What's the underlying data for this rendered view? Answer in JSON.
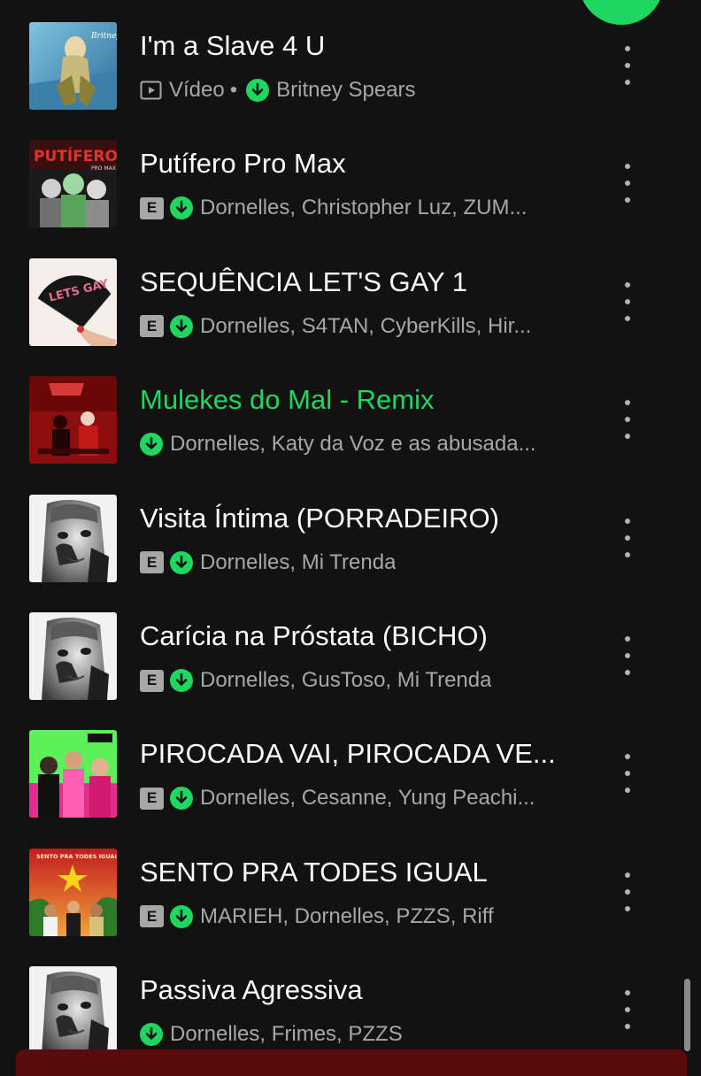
{
  "colors": {
    "background": "#121212",
    "accent_green": "#1ed760",
    "secondary_text": "#a7a7a7",
    "mini_player": "#5a0c0c"
  },
  "tracks": [
    {
      "title": "I'm a Slave 4 U",
      "type_label": "Vídeo",
      "explicit": false,
      "downloaded": true,
      "artists": "Britney Spears",
      "active": false,
      "cover_icon": "album-cover-britney"
    },
    {
      "title": "Putífero Pro Max",
      "explicit": true,
      "downloaded": true,
      "artists": "Dornelles, Christopher Luz, ZUM...",
      "active": false,
      "cover_icon": "album-cover-putifero"
    },
    {
      "title": "SEQUÊNCIA LET'S GAY 1",
      "explicit": true,
      "downloaded": true,
      "artists": "Dornelles, S4TAN, CyberKills, Hir...",
      "active": false,
      "cover_icon": "album-cover-lets-gay"
    },
    {
      "title": "Mulekes do Mal - Remix",
      "explicit": false,
      "downloaded": true,
      "artists": "Dornelles, Katy da Voz e as abusada...",
      "active": true,
      "cover_icon": "album-cover-mulekes"
    },
    {
      "title": "Visita Íntima (PORRADEIRO)",
      "explicit": true,
      "downloaded": true,
      "artists": "Dornelles, Mi Trenda",
      "active": false,
      "cover_icon": "album-cover-bw-portrait"
    },
    {
      "title": "Carícia na Próstata (BICHO)",
      "explicit": true,
      "downloaded": true,
      "artists": "Dornelles, GusToso, Mi Trenda",
      "active": false,
      "cover_icon": "album-cover-bw-portrait"
    },
    {
      "title": "PIROCADA VAI, PIROCADA VE...",
      "explicit": true,
      "downloaded": true,
      "artists": "Dornelles, Cesanne, Yung Peachi...",
      "active": false,
      "cover_icon": "album-cover-pirocada"
    },
    {
      "title": "SENTO PRA TODES IGUAL",
      "explicit": true,
      "downloaded": true,
      "artists": "MARIEH, Dornelles, PZZS, Riff",
      "active": false,
      "cover_icon": "album-cover-sento"
    },
    {
      "title": "Passiva Agressiva",
      "explicit": false,
      "downloaded": true,
      "artists": "Dornelles, Frimes, PZZS",
      "active": false,
      "cover_icon": "album-cover-bw-portrait"
    }
  ],
  "labels": {
    "explicit_badge": "E",
    "separator": "•"
  },
  "cover_texts": {
    "britney": "Britney",
    "putifero": "PUTÍFERO",
    "putifero_sub": "PRO MAX",
    "lets_gay": "LETS GAY",
    "sento": "SENTO PRA TODES IGUAL"
  }
}
